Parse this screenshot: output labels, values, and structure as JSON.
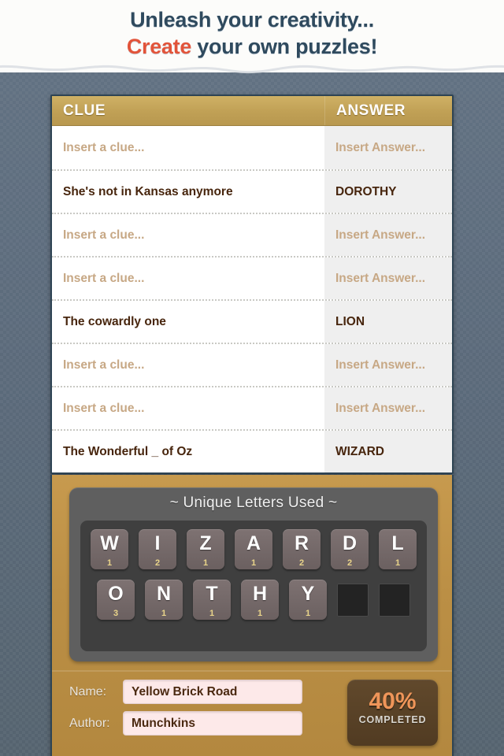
{
  "header": {
    "line1": "Unleash your creativity...",
    "line2_accent": "Create",
    "line2_rest": " your own puzzles!"
  },
  "table": {
    "columns": [
      "CLUE",
      "ANSWER"
    ],
    "placeholder_clue": "Insert a clue...",
    "placeholder_answer": "Insert Answer...",
    "rows": [
      {
        "clue": "Insert a clue...",
        "answer": "Insert Answer...",
        "filled": false
      },
      {
        "clue": "She's not in Kansas anymore",
        "answer": "DOROTHY",
        "filled": true
      },
      {
        "clue": "Insert a clue...",
        "answer": "Insert Answer...",
        "filled": false
      },
      {
        "clue": "Insert a clue...",
        "answer": "Insert Answer...",
        "filled": false
      },
      {
        "clue": "The cowardly one",
        "answer": "LION",
        "filled": true
      },
      {
        "clue": "Insert a clue...",
        "answer": "Insert Answer...",
        "filled": false
      },
      {
        "clue": "Insert a clue...",
        "answer": "Insert Answer...",
        "filled": false
      },
      {
        "clue": "The Wonderful _ of Oz",
        "answer": "WIZARD",
        "filled": true
      }
    ]
  },
  "letters_panel": {
    "title": "~ Unique Letters Used ~",
    "rows": [
      [
        {
          "letter": "W",
          "count": "1"
        },
        {
          "letter": "I",
          "count": "2"
        },
        {
          "letter": "Z",
          "count": "1"
        },
        {
          "letter": "A",
          "count": "1"
        },
        {
          "letter": "R",
          "count": "2"
        },
        {
          "letter": "D",
          "count": "2"
        },
        {
          "letter": "L",
          "count": "1"
        }
      ],
      [
        {
          "letter": "O",
          "count": "3"
        },
        {
          "letter": "N",
          "count": "1"
        },
        {
          "letter": "T",
          "count": "1"
        },
        {
          "letter": "H",
          "count": "1"
        },
        {
          "letter": "Y",
          "count": "1"
        },
        {
          "letter": "",
          "count": ""
        },
        {
          "letter": "",
          "count": ""
        }
      ]
    ]
  },
  "form": {
    "name_label": "Name:",
    "name_value": "Yellow Brick Road",
    "author_label": "Author:",
    "author_value": "Munchkins"
  },
  "progress": {
    "percent": "40%",
    "label": "COMPLETED"
  },
  "colors": {
    "background": "#5c6b7c",
    "header_gold": "#c0a055",
    "gold_panel": "#bb8f45",
    "accent_red": "#e2543a",
    "title_blue": "#2f4a5e",
    "filled_text": "#47250d",
    "placeholder_text": "#c7a885",
    "progress_orange": "#ef9559"
  }
}
